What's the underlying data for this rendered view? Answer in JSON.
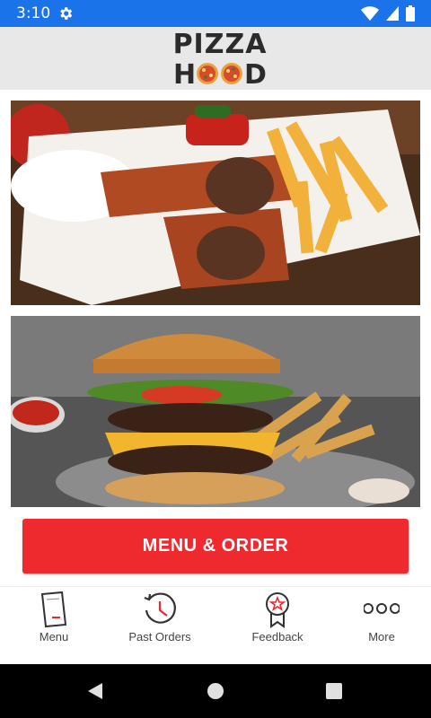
{
  "status_bar": {
    "time": "3:10"
  },
  "header": {
    "logo_line1": "PIZZA",
    "logo_line2": "HOOD"
  },
  "cta": {
    "label": "MENU & ORDER"
  },
  "bottom_nav": {
    "items": [
      {
        "label": "Menu",
        "icon": "menu-book-icon"
      },
      {
        "label": "Past Orders",
        "icon": "history-clock-icon"
      },
      {
        "label": "Feedback",
        "icon": "award-star-icon"
      },
      {
        "label": "More",
        "icon": "more-dots-icon"
      }
    ]
  },
  "colors": {
    "status_bar": "#1a73e8",
    "cta": "#ee2a2f",
    "header_bg": "#e8e8e8"
  }
}
